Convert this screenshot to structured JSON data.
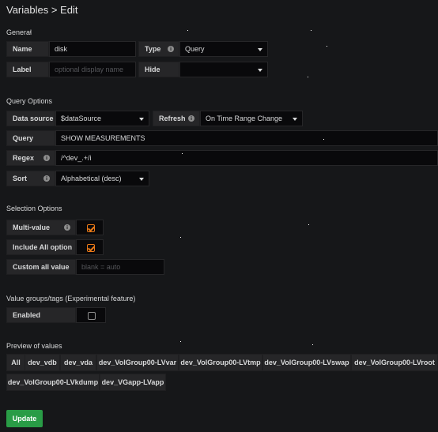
{
  "page": {
    "title": "Variables > Edit"
  },
  "general": {
    "heading": "General",
    "name_label": "Name",
    "name_value": "disk",
    "type_label": "Type",
    "type_value": "Query",
    "label_label": "Label",
    "label_placeholder": "optional display name",
    "hide_label": "Hide",
    "hide_value": ""
  },
  "query_options": {
    "heading": "Query Options",
    "datasource_label": "Data source",
    "datasource_value": "$dataSource",
    "refresh_label": "Refresh",
    "refresh_value": "On Time Range Change",
    "query_label": "Query",
    "query_value": "SHOW MEASUREMENTS",
    "regex_label": "Regex",
    "regex_value": "/^dev_.+/i",
    "sort_label": "Sort",
    "sort_value": "Alphabetical (desc)"
  },
  "selection_options": {
    "heading": "Selection Options",
    "multi_label": "Multi-value",
    "multi_checked": true,
    "include_all_label": "Include All option",
    "include_all_checked": true,
    "custom_all_label": "Custom all value",
    "custom_all_placeholder": "blank = auto"
  },
  "value_groups": {
    "heading": "Value groups/tags (Experimental feature)",
    "enabled_label": "Enabled",
    "enabled_checked": false
  },
  "preview": {
    "heading": "Preview of values",
    "values": [
      "All",
      "dev_vdb",
      "dev_vda",
      "dev_VolGroup00-LVvar",
      "dev_VolGroup00-LVtmp",
      "dev_VolGroup00-LVswap",
      "dev_VolGroup00-LVroot",
      "dev_VolGroup00-LVkdump",
      "dev_VGapp-LVapp"
    ]
  },
  "actions": {
    "update_label": "Update"
  },
  "colors": {
    "accent": "#eb7b18",
    "primary_button": "#299c46",
    "background": "#161719"
  },
  "icons": {
    "info": "info-circle-icon",
    "caret": "chevron-down-icon",
    "check": "checkmark-icon"
  }
}
